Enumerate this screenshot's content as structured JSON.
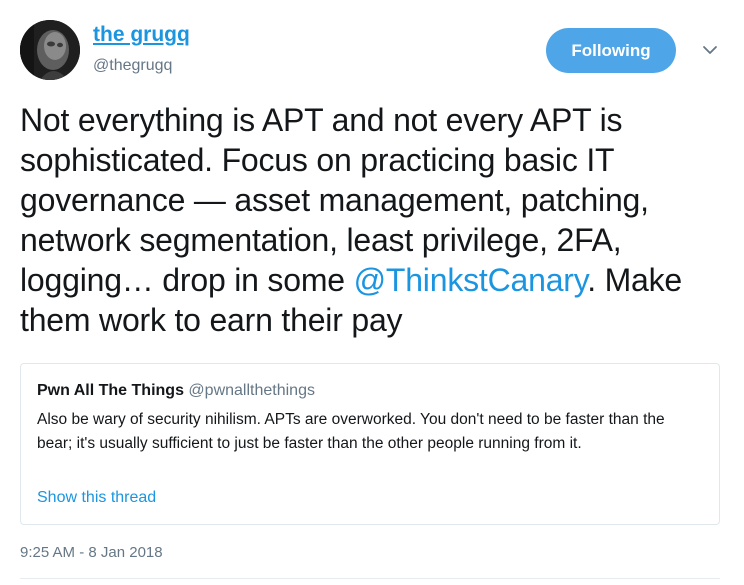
{
  "author": {
    "display_name": "the grugq",
    "handle": "@thegrugq",
    "avatar_icon": "avatar-photo"
  },
  "follow_button": {
    "label": "Following",
    "color": "#4ea6e8"
  },
  "menu": {
    "icon": "chevron-down-icon"
  },
  "tweet": {
    "text_before": "Not everything is APT and not every APT is sophisticated. Focus on practicing basic IT governance — asset management, patching, network segmentation, least privilege, 2FA, logging… drop in some ",
    "mention": "@ThinkstCanary",
    "text_after": ". Make them work to earn their pay"
  },
  "quote": {
    "name": "Pwn All The Things",
    "handle": "@pwnallthethings",
    "text": "Also be wary of security nihilism. APTs are overworked. You don't need to be faster than the bear; it's usually sufficient to just be faster than the other people running from it.",
    "show_thread": "Show this thread"
  },
  "timestamp": "9:25 AM - 8 Jan 2018",
  "colors": {
    "link": "#1b95e0",
    "secondary_text": "#657786",
    "primary_text": "#14171a",
    "border": "#e1e8ed"
  }
}
